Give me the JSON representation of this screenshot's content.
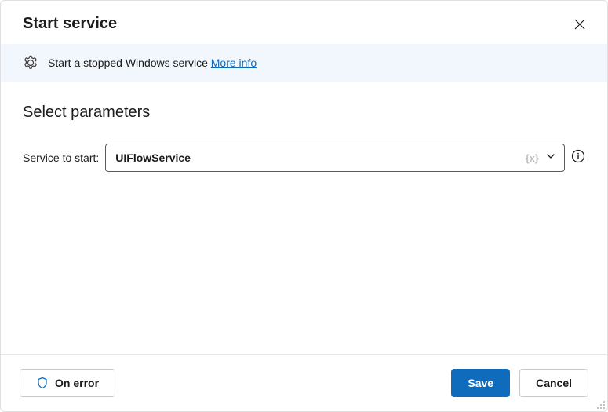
{
  "header": {
    "title": "Start service"
  },
  "banner": {
    "text": "Start a stopped Windows service ",
    "moreInfo": "More info"
  },
  "section": {
    "heading": "Select parameters"
  },
  "field": {
    "label": "Service to start:",
    "value": "UIFlowService",
    "varPlaceholder": "{x}"
  },
  "footer": {
    "onError": "On error",
    "save": "Save",
    "cancel": "Cancel"
  }
}
